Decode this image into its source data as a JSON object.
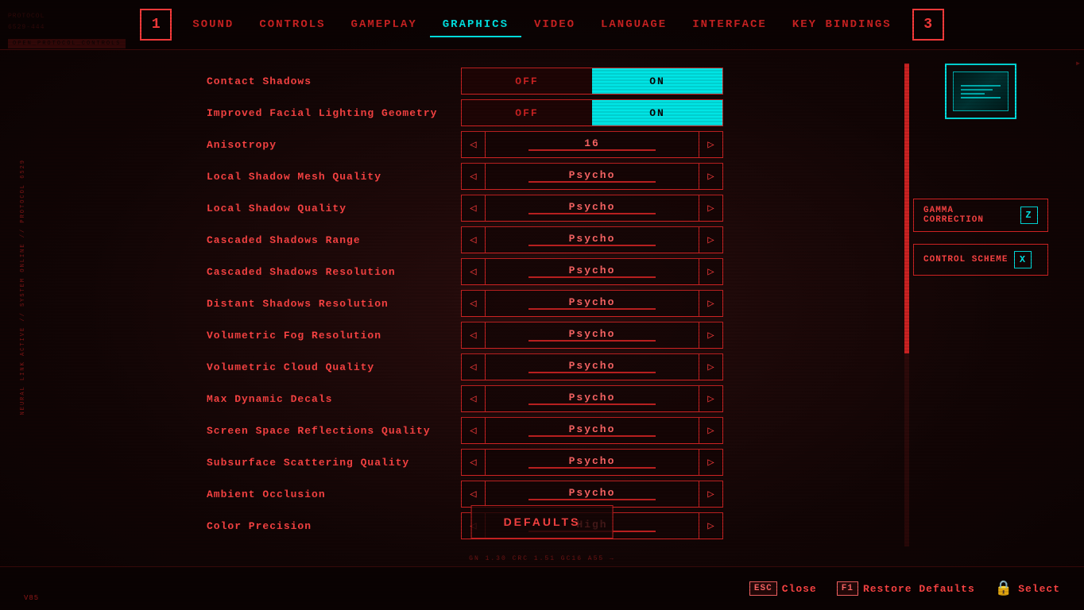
{
  "nav": {
    "left_number": "1",
    "right_number": "3",
    "items": [
      {
        "label": "SOUND",
        "active": false
      },
      {
        "label": "CONTROLS",
        "active": false
      },
      {
        "label": "GAMEPLAY",
        "active": false
      },
      {
        "label": "GRAPHICS",
        "active": true
      },
      {
        "label": "VIDEO",
        "active": false
      },
      {
        "label": "LANGUAGE",
        "active": false
      },
      {
        "label": "INTERFACE",
        "active": false
      },
      {
        "label": "KEY BINDINGS",
        "active": false
      }
    ]
  },
  "settings": [
    {
      "label": "Contact Shadows",
      "type": "toggle",
      "value": "ON"
    },
    {
      "label": "Improved Facial Lighting Geometry",
      "type": "toggle",
      "value": "ON"
    },
    {
      "label": "Anisotropy",
      "type": "slider",
      "value": "16"
    },
    {
      "label": "Local Shadow Mesh Quality",
      "type": "slider",
      "value": "Psycho"
    },
    {
      "label": "Local Shadow Quality",
      "type": "slider",
      "value": "Psycho"
    },
    {
      "label": "Cascaded Shadows Range",
      "type": "slider",
      "value": "Psycho"
    },
    {
      "label": "Cascaded Shadows Resolution",
      "type": "slider",
      "value": "Psycho"
    },
    {
      "label": "Distant Shadows Resolution",
      "type": "slider",
      "value": "Psycho"
    },
    {
      "label": "Volumetric Fog Resolution",
      "type": "slider",
      "value": "Psycho"
    },
    {
      "label": "Volumetric Cloud Quality",
      "type": "slider",
      "value": "Psycho"
    },
    {
      "label": "Max Dynamic Decals",
      "type": "slider",
      "value": "Psycho"
    },
    {
      "label": "Screen Space Reflections Quality",
      "type": "slider",
      "value": "Psycho"
    },
    {
      "label": "Subsurface Scattering Quality",
      "type": "slider",
      "value": "Psycho"
    },
    {
      "label": "Ambient Occlusion",
      "type": "slider",
      "value": "Psycho"
    },
    {
      "label": "Color Precision",
      "type": "slider",
      "value": "High"
    }
  ],
  "sidebar": {
    "protocol_lines": [
      "PROTOCOL",
      "6529-444"
    ],
    "badge_text": "OPEN_PROTOCOL_CONTROLS"
  },
  "right_panel": {
    "gamma_label": "GAMMA CORRECTION",
    "gamma_key": "Z",
    "scheme_label": "CONTROL SCHEME",
    "scheme_key": "X"
  },
  "defaults_btn": "DEFAULTS",
  "bottom": {
    "close_key": "ESC",
    "close_label": "Close",
    "restore_key": "F1",
    "restore_label": "Restore Defaults",
    "select_label": "Select"
  },
  "version": {
    "v": "V",
    "num": "85"
  },
  "tech_text": "GN 1.30 CRC 1.51 GC16 A55",
  "right_corner_text": "▶"
}
